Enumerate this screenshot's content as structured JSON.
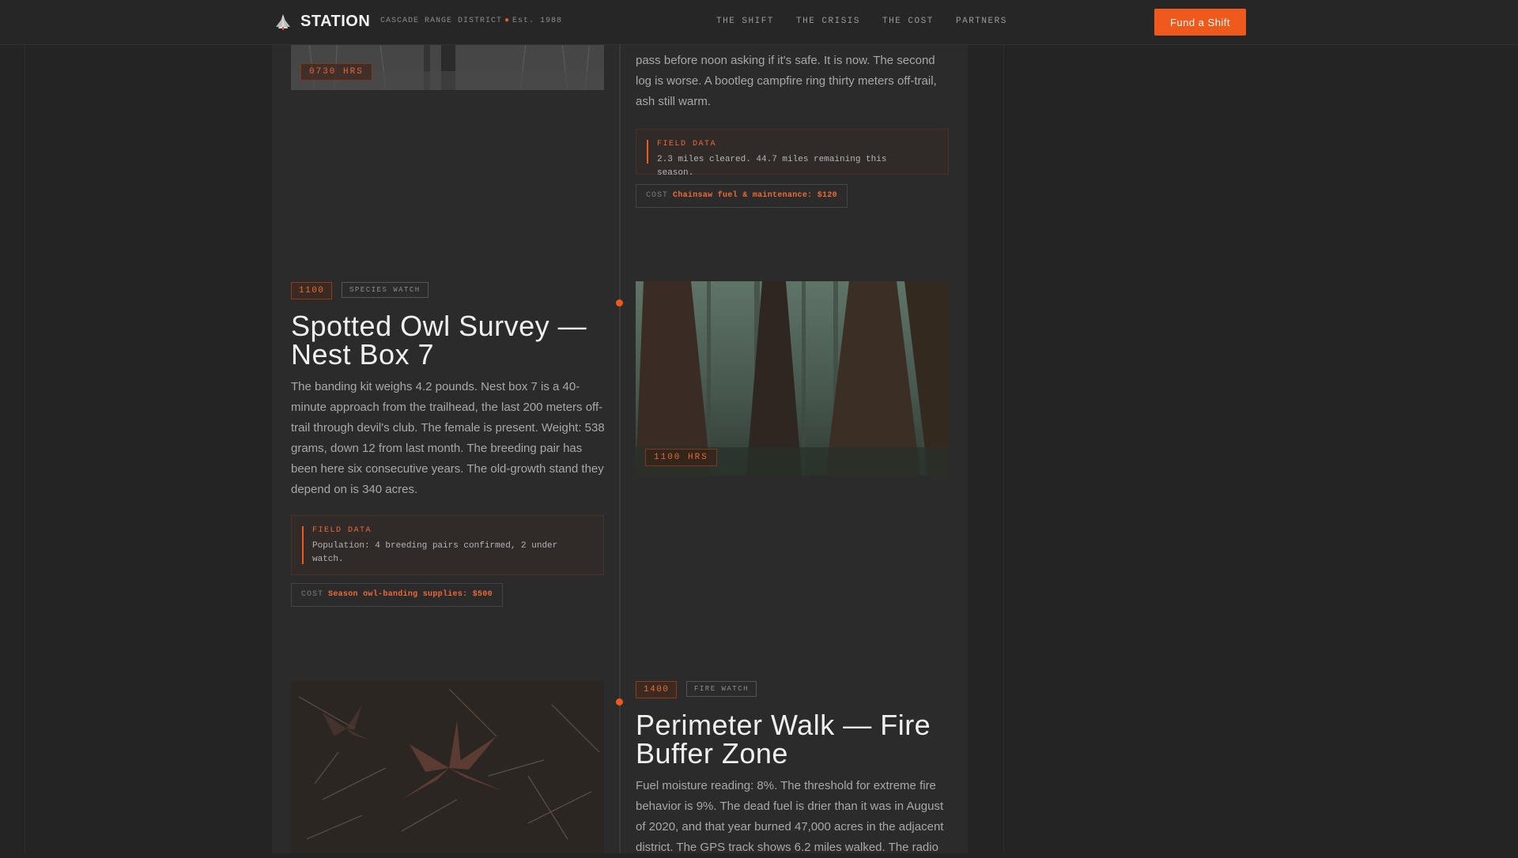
{
  "header": {
    "brand": "STATION",
    "tagline_district": "CASCADE RANGE DISTRICT",
    "tagline_est": "Est. 1988",
    "nav": [
      "THE SHIFT",
      "THE CRISIS",
      "THE COST",
      "PARTNERS"
    ],
    "cta_label": "Fund a Shift"
  },
  "entry_0730": {
    "image_tag": "0730 HRS",
    "text_partial": "pass before noon asking if it's safe. It is now. The second log is worse. A bootleg campfire ring thirty meters off-trail, ash still warm.",
    "field_label": "FIELD DATA",
    "field_value": "2.3 miles cleared. 44.7 miles remaining this season.",
    "cost_key": "COST",
    "cost_value": "Chainsaw fuel & maintenance: $120"
  },
  "entry_1100": {
    "time": "1100",
    "type": "SPECIES WATCH",
    "title": "Spotted Owl Survey — Nest Box 7",
    "body": "The banding kit weighs 4.2 pounds. Nest box 7 is a 40-minute approach from the trailhead, the last 200 meters off-trail through devil's club. The female is present. Weight: 538 grams, down 12 from last month. The breeding pair has been here six consecutive years. The old-growth stand they depend on is 340 acres.",
    "field_label": "FIELD DATA",
    "field_value": "Population: 4 breeding pairs confirmed, 2 under watch.",
    "cost_key": "COST",
    "cost_value": "Season owl-banding supplies: $500",
    "image_tag": "1100 HRS"
  },
  "entry_1400": {
    "time": "1400",
    "type": "FIRE WATCH",
    "title": "Perimeter Walk — Fire Buffer Zone",
    "body": "Fuel moisture reading: 8%. The threshold for extreme fire behavior is 9%. The dead fuel is drier than it was in August of 2020, and that year burned 47,000 acres in the adjacent district. The GPS track shows 6.2 miles walked. The radio"
  }
}
